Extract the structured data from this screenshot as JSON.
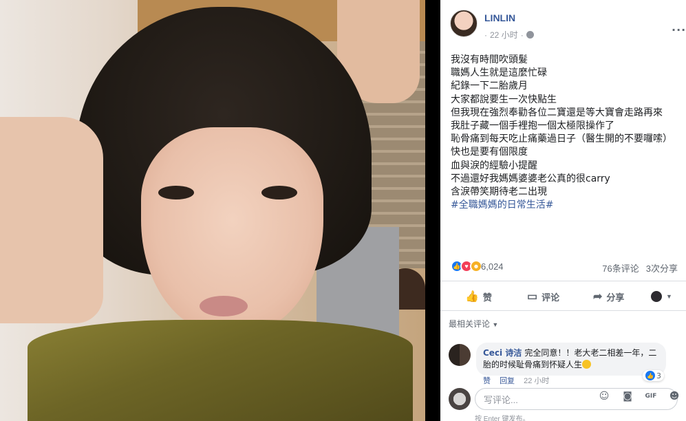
{
  "post": {
    "author": "LINLIN",
    "time": "22 小时",
    "separator": "·",
    "more": "···",
    "text_lines": [
      "我沒有時間吹頭髮",
      "職媽人生就是這麼忙碌",
      "紀錄一下二胎歲月",
      "大家都說要生一次快點生",
      "但我現在強烈奉勸各位二寶還是等大寶會走路再來",
      "我肚子藏一個手裡抱一個太極限操作了",
      "恥骨痛到每天吃止痛藥過日子（醫生開的不要囉嗦）",
      "快也是要有個限度",
      "血與淚的經驗小提醒",
      "不過還好我媽媽婆婆老公真的很carry",
      "含淚帶笑期待老二出現"
    ],
    "hashtag": "#全職媽媽的日常生活#"
  },
  "stats": {
    "reactions": "6,024",
    "comments": "76条评论",
    "shares": "3次分享"
  },
  "actions": {
    "like": "赞",
    "comment": "评论",
    "share": "分享"
  },
  "comments_section": {
    "sort_label": "最相关评论",
    "comment": {
      "name": "Ceci 诗洁",
      "text": "完全同意！！老大老二相差一年，二胎的时候耻骨痛到怀疑人生",
      "likes": "3",
      "like_action": "赞",
      "reply_action": "回复",
      "time": "22 小时"
    }
  },
  "composer": {
    "placeholder": "写评论...",
    "hint": "按 Enter 键发布。"
  },
  "colors": {
    "link": "#365899",
    "muted": "#90949c",
    "like_blue": "#1877f2",
    "love_red": "#f33e58",
    "haha_yellow": "#f7b125"
  }
}
